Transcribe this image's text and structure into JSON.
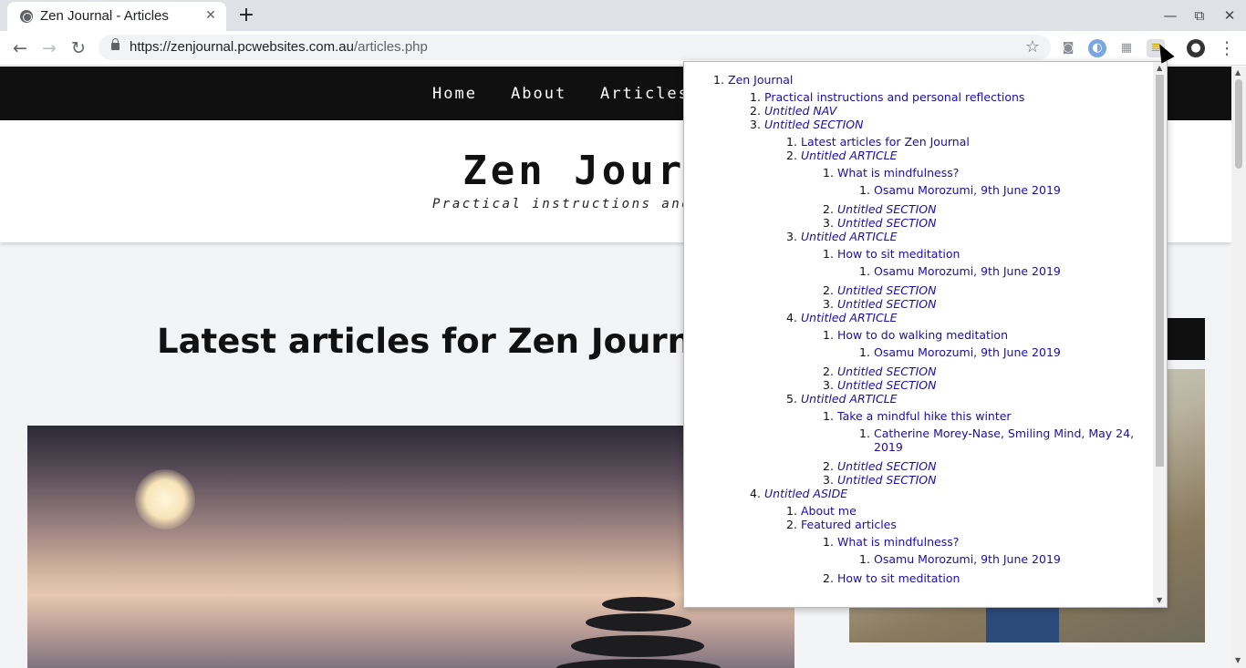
{
  "browser": {
    "tab_title": "Zen Journal - Articles",
    "url_host": "https://zenjournal.pcwebsites.com.au",
    "url_path": "/articles.php",
    "new_tab": "+",
    "close": "✕",
    "minimize": "—",
    "restore": "⧉",
    "window_close": "✕"
  },
  "site": {
    "nav": [
      "Home",
      "About",
      "Articles"
    ],
    "title": "Zen Journal",
    "subtitle": "Practical instructions and personal reflections",
    "main_heading": "Latest articles for Zen Journal"
  },
  "outline": {
    "root": "Zen Journal",
    "l1_1": "Practical instructions and personal reflections",
    "l1_2": "Untitled NAV",
    "l1_3": "Untitled SECTION",
    "sec_1": "Latest articles for Zen Journal",
    "articles": [
      {
        "label": "Untitled ARTICLE",
        "heading": "What is mindfulness?",
        "byline": "Osamu Morozumi, 9th June 2019",
        "s2": "Untitled SECTION",
        "s3": "Untitled SECTION"
      },
      {
        "label": "Untitled ARTICLE",
        "heading": "How to sit meditation",
        "byline": "Osamu Morozumi, 9th June 2019",
        "s2": "Untitled SECTION",
        "s3": "Untitled SECTION"
      },
      {
        "label": "Untitled ARTICLE",
        "heading": "How to do walking meditation",
        "byline": "Osamu Morozumi, 9th June 2019",
        "s2": "Untitled SECTION",
        "s3": "Untitled SECTION"
      },
      {
        "label": "Untitled ARTICLE",
        "heading": "Take a mindful hike this winter",
        "byline": "Catherine Morey-Nase, Smiling Mind, May 24, 2019",
        "s2": "Untitled SECTION",
        "s3": "Untitled SECTION"
      }
    ],
    "aside": "Untitled ASIDE",
    "aside_1": "About me",
    "aside_2": "Featured articles",
    "feat_1": "What is mindfulness?",
    "feat_1_byline": "Osamu Morozumi, 9th June 2019",
    "feat_2": "How to sit meditation"
  }
}
